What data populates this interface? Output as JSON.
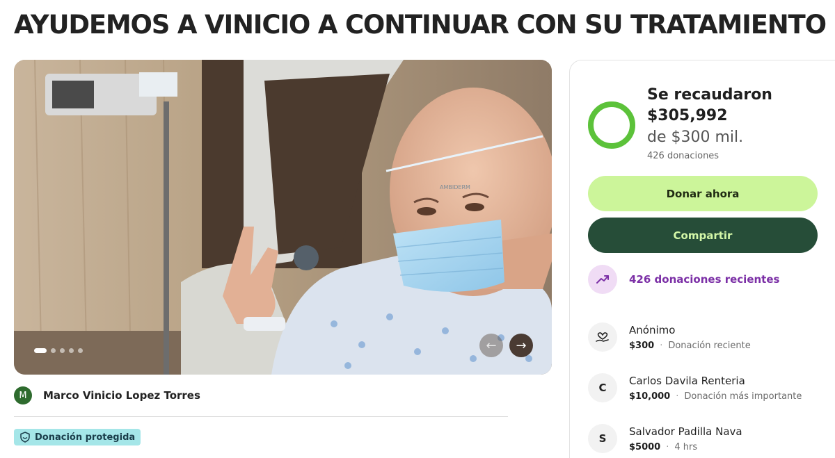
{
  "campaign": {
    "title": "AYUDEMOS A VINICIO A CONTINUAR CON SU TRATAMIENTO"
  },
  "carousel": {
    "slide_count": 5,
    "active_index": 0,
    "photo_text": "AMBIDERM",
    "prev_icon": "arrow-left-icon",
    "next_icon": "arrow-right-icon",
    "prev_glyph": "←",
    "next_glyph": "→"
  },
  "organizer": {
    "initial": "M",
    "name": "Marco Vinicio Lopez Torres"
  },
  "badge": {
    "label": "Donación protegida"
  },
  "stats": {
    "raised_label": "Se recaudaron",
    "raised_amount": "$305,992",
    "goal": "de $300 mil.",
    "donation_count": "426 donaciones",
    "progress_fraction": 1.0
  },
  "actions": {
    "donate_label": "Donar ahora",
    "share_label": "Compartir"
  },
  "recent": {
    "label": "426 donaciones recientes"
  },
  "donors": [
    {
      "initial": "",
      "icon": "heart-hand-icon",
      "name": "Anónimo",
      "amount": "$300",
      "note": "Donación reciente"
    },
    {
      "initial": "C",
      "name": "Carlos Davila Renteria",
      "amount": "$10,000",
      "note": "Donación más importante"
    },
    {
      "initial": "S",
      "name": "Salvador Padilla Nava",
      "amount": "$5000",
      "note": "4 hrs"
    }
  ],
  "colors": {
    "accent_green": "#ccf59a",
    "dark_green": "#264d38",
    "ring_green": "#5cc23a",
    "purple": "#7b2fa6",
    "badge_teal": "#a5e6e8"
  }
}
